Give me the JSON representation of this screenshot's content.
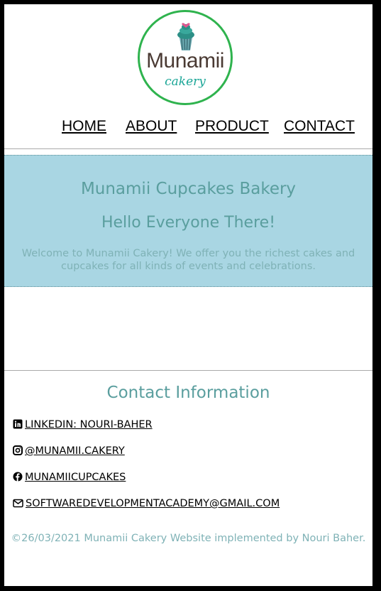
{
  "logo": {
    "brand": "Munamii",
    "sub": "cakery"
  },
  "nav": {
    "home": "HOME",
    "about": "ABOUT",
    "product": "PRODUCT",
    "contact": "CONTACT"
  },
  "hero": {
    "title": "Munamii Cupcakes Bakery",
    "subtitle": "Hello Everyone There!",
    "text": "Welcome to Munamii Cakery! We offer you the richest cakes and cupcakes for all kinds of events and celebrations."
  },
  "contact": {
    "title": "Contact Information",
    "linkedin": "LINKEDIN: NOURI-BAHER",
    "instagram": "@MUNAMII.CAKERY",
    "facebook": "MUNAMIICUPCAKES",
    "email": "SOFTWAREDEVELOPMENTACADEMY@GMAIL.COM"
  },
  "footer": {
    "text": "©26/03/2021 Munamii Cakery Website implemented by Nouri Baher."
  },
  "colors": {
    "accent": "#5a9e9e",
    "hero_bg": "#a9d6e3",
    "logo_ring": "#2fb34e"
  }
}
